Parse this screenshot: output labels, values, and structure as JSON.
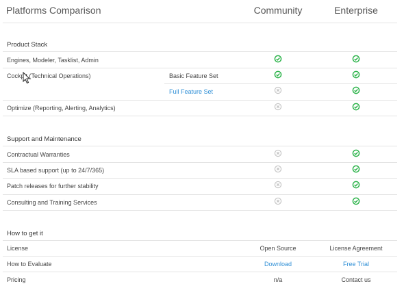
{
  "header": {
    "title": "Platforms Comparison",
    "col_community": "Community",
    "col_enterprise": "Enterprise"
  },
  "sections": {
    "product_stack": {
      "title": "Product Stack",
      "rows": [
        {
          "feature": "Engines, Modeler, Tasklist, Admin",
          "sub": "",
          "community": "yes",
          "enterprise": "yes"
        },
        {
          "feature": "Cockpit (Technical Operations)",
          "sub": "Basic Feature Set",
          "community": "yes",
          "enterprise": "yes"
        },
        {
          "feature": "",
          "sub": "Full Feature Set",
          "community": "no",
          "enterprise": "yes"
        },
        {
          "feature": "Optimize (Reporting, Alerting, Analytics)",
          "sub": "",
          "community": "no",
          "enterprise": "yes"
        }
      ]
    },
    "support": {
      "title": "Support and Maintenance",
      "rows": [
        {
          "feature": "Contractual Warranties",
          "community": "no",
          "enterprise": "yes"
        },
        {
          "feature": "SLA based support (up to 24/7/365)",
          "community": "no",
          "enterprise": "yes"
        },
        {
          "feature": "Patch releases for further stability",
          "community": "no",
          "enterprise": "yes"
        },
        {
          "feature": "Consulting and Training Services",
          "community": "no",
          "enterprise": "yes"
        }
      ]
    },
    "how_to": {
      "title": "How to get it",
      "rows": [
        {
          "feature": "License",
          "community": "Open Source",
          "enterprise": "License Agreement"
        },
        {
          "feature": "How to Evaluate",
          "community": "Download",
          "enterprise": "Free Trial"
        },
        {
          "feature": "Pricing",
          "community": "n/a",
          "enterprise": "Contact us"
        }
      ]
    }
  },
  "colors": {
    "check_green": "#2cb34a",
    "cross_gray": "#c4c4c4",
    "link_blue": "#2f8fd6",
    "divider": "#e3e3e3"
  },
  "icons": {
    "yes": "check-circle-icon",
    "no": "x-circle-icon",
    "cursor": "mouse-pointer-icon"
  }
}
